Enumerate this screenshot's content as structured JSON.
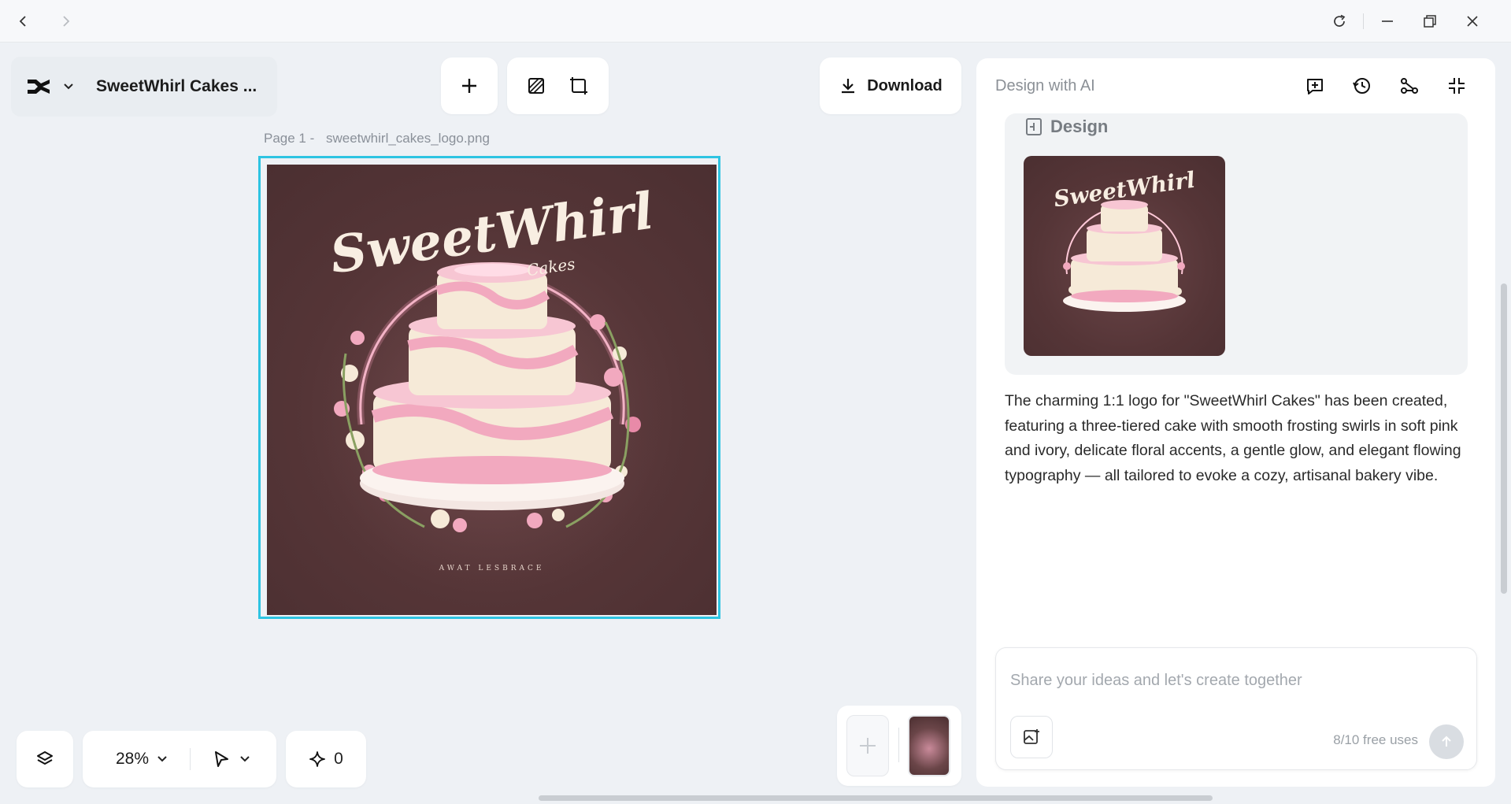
{
  "window": {
    "back_icon": "chevron-left-icon",
    "forward_icon": "chevron-right-icon",
    "refresh_icon": "refresh-icon",
    "minimize_icon": "minimize-icon",
    "restore_icon": "restore-icon",
    "close_icon": "close-icon"
  },
  "header": {
    "doc_title": "SweetWhirl Cakes ...",
    "download_label": "Download"
  },
  "canvas": {
    "page_label": "Page 1 -",
    "file_name": "sweetwhirl_cakes_logo.png",
    "art_title": "SweetWhirl",
    "art_subtitle": "Cakes",
    "art_tagline": "AWAT LESBRACE",
    "frame_color": "#2ec4e2"
  },
  "bottom_toolbar": {
    "zoom": "28%",
    "credits": "0"
  },
  "panel": {
    "title": "Design with AI",
    "design_heading": "Design",
    "description": "The charming 1:1 logo for \"SweetWhirl Cakes\" has been created, featuring a three-tiered cake with smooth frosting swirls in soft pink and ivory, delicate floral accents, a gentle glow, and elegant flowing typography — all tailored to evoke a cozy, artisanal bakery vibe.",
    "input_placeholder": "Share your ideas and let's create together",
    "free_uses": "8/10 free uses"
  },
  "colors": {
    "accent": "#2ec4e2",
    "art_background": "#553537",
    "frosting_pink": "#f2a9bf",
    "ivory": "#f6ead8"
  }
}
